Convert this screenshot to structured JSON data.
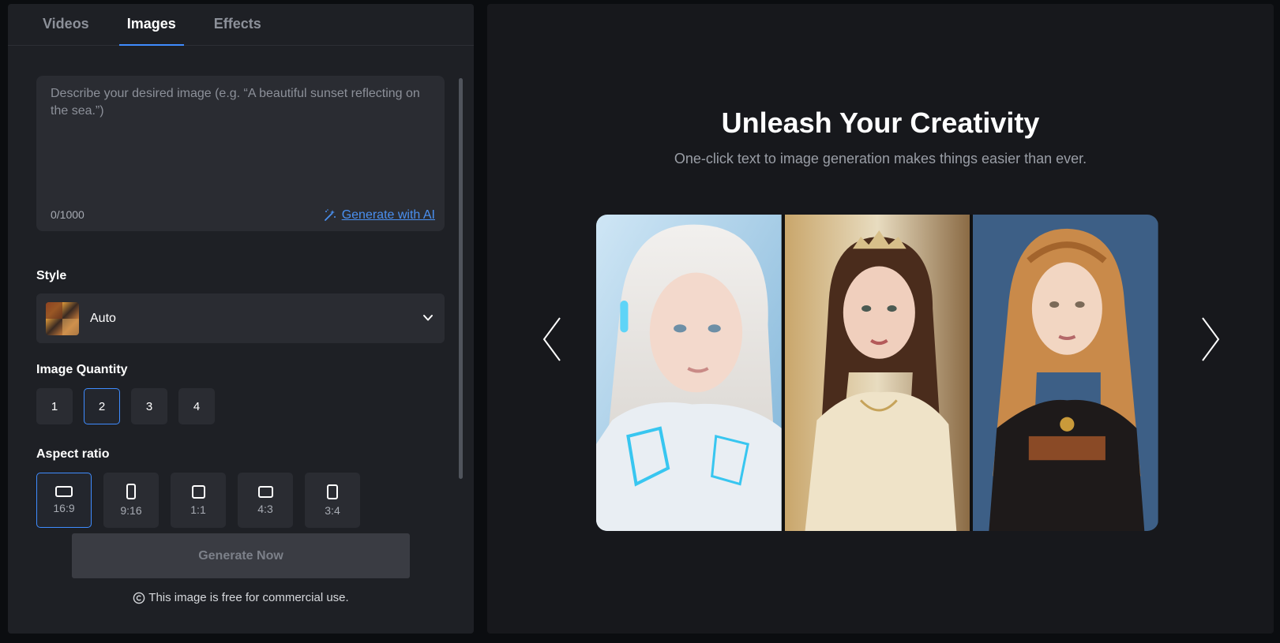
{
  "tabs": [
    {
      "label": "Videos",
      "active": false
    },
    {
      "label": "Images",
      "active": true
    },
    {
      "label": "Effects",
      "active": false
    }
  ],
  "prompt": {
    "placeholder": "Describe your desired image (e.g. “A beautiful sunset reflecting on the sea.”)",
    "value": "",
    "char_count": "0/1000",
    "generate_ai_label": "Generate with AI"
  },
  "style": {
    "label": "Style",
    "selected": "Auto"
  },
  "quantity": {
    "label": "Image Quantity",
    "options": [
      "1",
      "2",
      "3",
      "4"
    ],
    "selected": "2"
  },
  "aspect_ratio": {
    "label": "Aspect ratio",
    "options": [
      "16:9",
      "9:16",
      "1:1",
      "4:3",
      "3:4"
    ],
    "selected": "16:9"
  },
  "generate_button": "Generate Now",
  "notice": "This image is free for commercial use.",
  "hero": {
    "title": "Unleash Your Creativity",
    "subtitle": "One-click text to image generation makes things easier than ever."
  },
  "gallery": {
    "images": [
      "cyber-woman-portrait",
      "princess-portrait",
      "renaissance-woman-portrait"
    ]
  },
  "colors": {
    "accent": "#3f8cff",
    "panel": "#1e2025",
    "link": "#4a90f0"
  }
}
